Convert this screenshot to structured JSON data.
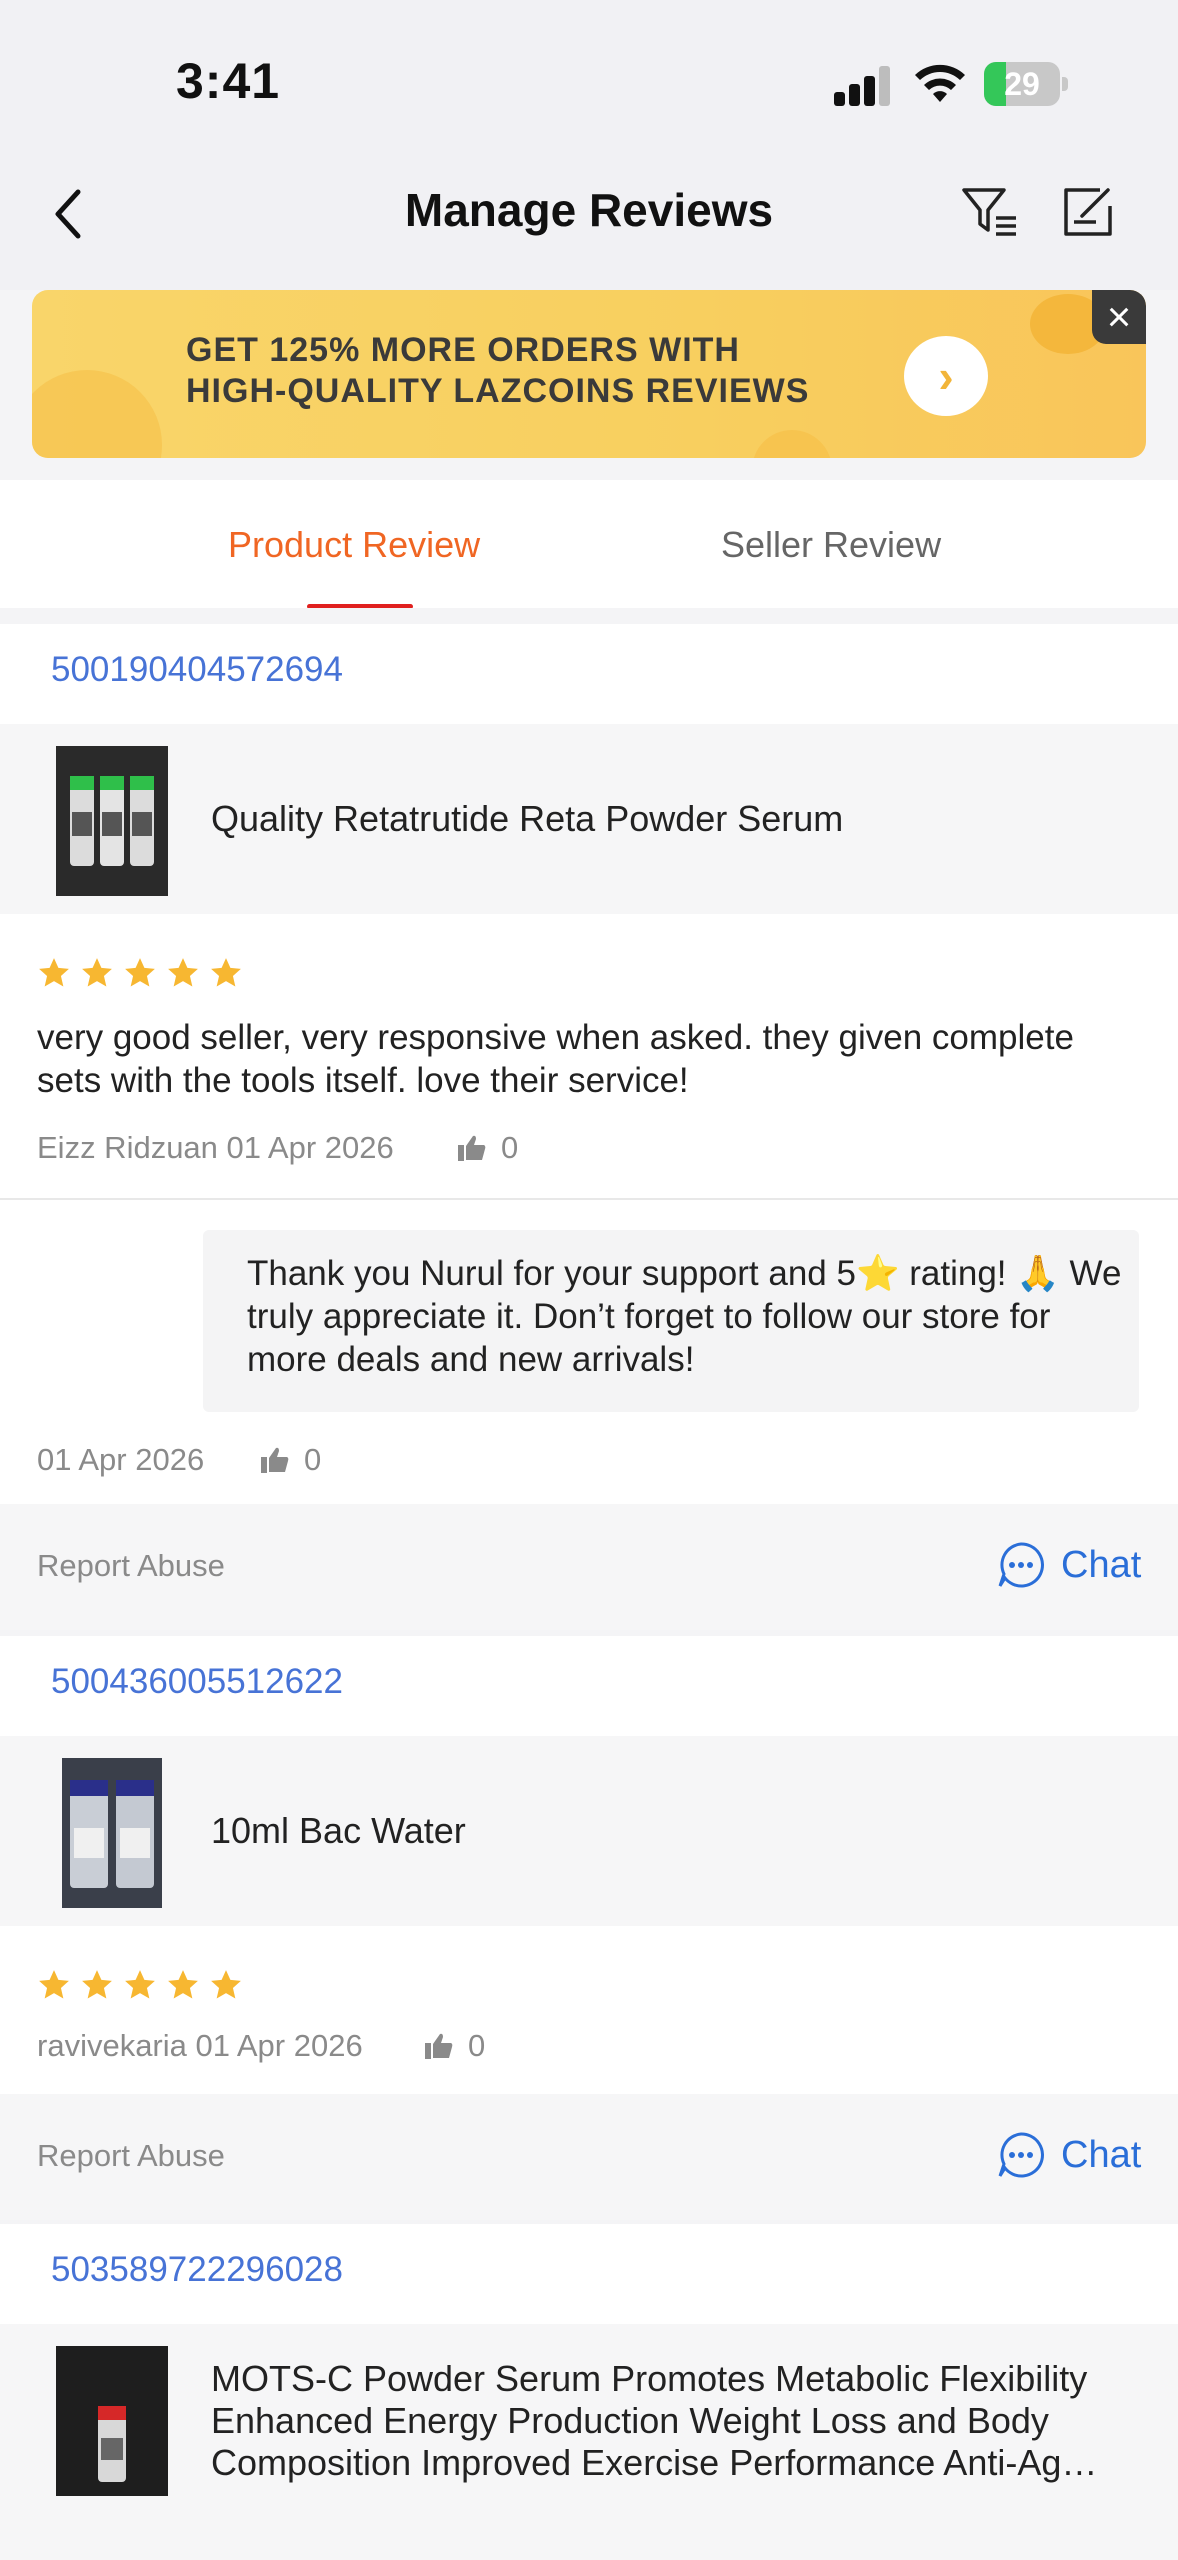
{
  "status_bar": {
    "time": "3:41",
    "battery": "29"
  },
  "nav": {
    "title": "Manage Reviews"
  },
  "banner": {
    "line1": "GET 125% MORE ORDERS WITH",
    "line2": "HIGH-QUALITY LAZCOINS REVIEWS"
  },
  "tabs": [
    {
      "label": "Product Review",
      "active": true
    },
    {
      "label": "Seller Review",
      "active": false
    }
  ],
  "reviews": [
    {
      "order_id": "500190404572694",
      "product": "Quality Retatrutide Reta Powder Serum",
      "rating": 5,
      "text": "very good seller, very responsive when asked. they given complete sets with the tools itself. love their service!",
      "meta": "Eizz Ridzuan 01 Apr 2026",
      "likes": "0",
      "reply": {
        "text": "Thank you Nurul for your support and 5⭐ rating! 🙏 We truly appreciate it. Don’t forget to follow our store for more deals and new arrivals!",
        "date": "01 Apr 2026",
        "likes": "0"
      },
      "report_label": "Report Abuse",
      "chat_label": "Chat"
    },
    {
      "order_id": "500436005512622",
      "product": "10ml Bac Water",
      "rating": 5,
      "meta": "ravivekaria 01 Apr 2026",
      "likes": "0",
      "report_label": "Report Abuse",
      "chat_label": "Chat"
    },
    {
      "order_id": "503589722296028",
      "product": "MOTS-C Powder Serum Promotes Metabolic Flexibility Enhanced Energy Production Weight Loss and Body Composition Improved Exercise Performance Anti-Ag…"
    }
  ],
  "colors": {
    "accent_orange": "#f06623",
    "tab_underline": "#e0201e",
    "link_blue": "#4773d6",
    "chat_blue": "#2a6ed8",
    "star": "#f7b731"
  }
}
